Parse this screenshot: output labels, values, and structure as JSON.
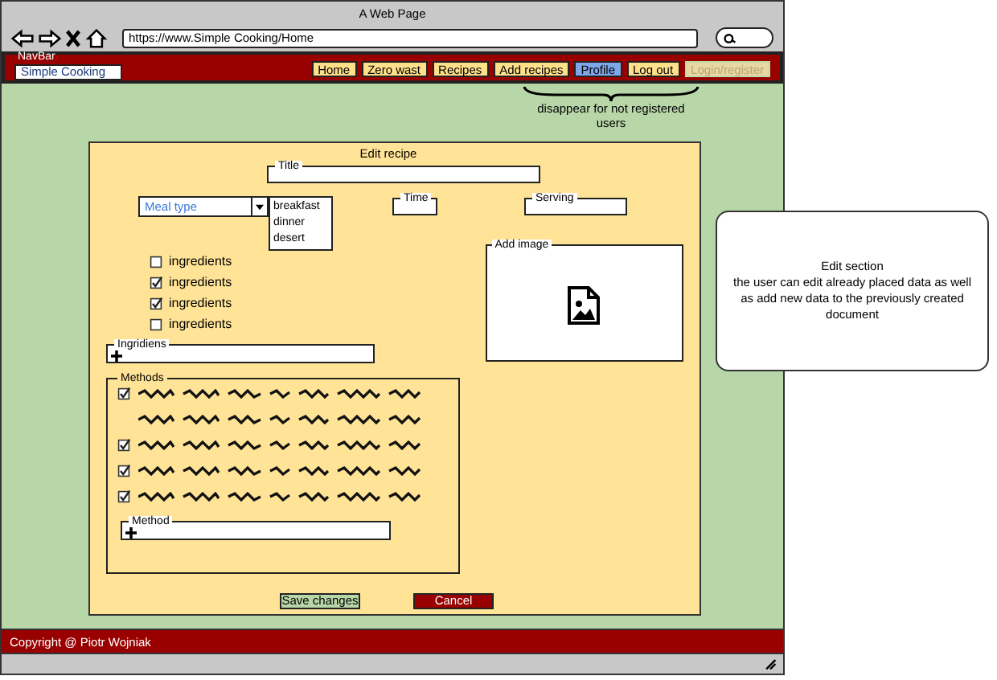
{
  "window": {
    "title": "A Web Page"
  },
  "browser": {
    "url": "https://www.Simple Cooking/Home"
  },
  "navbar": {
    "label": "NavBar",
    "site_name": "Simple Cooking",
    "links": [
      {
        "label": "Home",
        "selected": false,
        "disabled": false
      },
      {
        "label": "Zero wast",
        "selected": false,
        "disabled": false
      },
      {
        "label": "Recipes",
        "selected": false,
        "disabled": false
      },
      {
        "label": "Add recipes",
        "selected": false,
        "disabled": false
      },
      {
        "label": "Profile",
        "selected": true,
        "disabled": false
      },
      {
        "label": "Log out",
        "selected": false,
        "disabled": false
      },
      {
        "label": "Login/register",
        "selected": false,
        "disabled": true
      }
    ]
  },
  "annotation": "disappear for not registered users",
  "form": {
    "title": "Edit recipe",
    "title_field": {
      "label": "Title"
    },
    "meal_type": {
      "value": "Meal type",
      "options": [
        "breakfast",
        "dinner",
        "desert"
      ]
    },
    "time_field": {
      "label": "Time"
    },
    "serving_field": {
      "label": "Serving"
    },
    "ingredients": [
      {
        "label": "ingredients",
        "checked": false
      },
      {
        "label": "ingredients",
        "checked": true
      },
      {
        "label": "ingredients",
        "checked": true
      },
      {
        "label": "ingredients",
        "checked": false
      }
    ],
    "image": {
      "label": "Add image"
    },
    "ingredient_field": {
      "label": "Ingridiens"
    },
    "methods": {
      "label": "Methods",
      "steps": [
        {
          "kind": "step",
          "checked": true
        },
        {
          "kind": "continuation"
        },
        {
          "kind": "step",
          "checked": true
        },
        {
          "kind": "step",
          "checked": true
        },
        {
          "kind": "step",
          "checked": true
        }
      ],
      "method_field": {
        "label": "Method"
      }
    },
    "buttons": [
      {
        "label": "Save changes",
        "kind": "save"
      },
      {
        "label": "Cancel",
        "kind": "cancel"
      }
    ]
  },
  "callout": {
    "heading": "Edit section",
    "text": "the user can edit already placed data as well as add new data to the previously created document"
  },
  "footer": "Copyright @ Piotr Wojniak"
}
